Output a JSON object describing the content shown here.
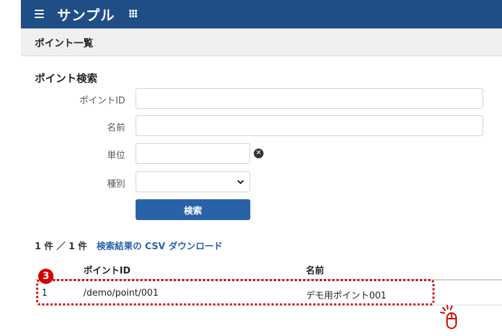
{
  "header": {
    "app_title": "サンプル",
    "menu_icon": "hamburger-menu-icon",
    "apps_icon": "grid-apps-icon"
  },
  "page": {
    "title": "ポイント一覧"
  },
  "search": {
    "section_title": "ポイント検索",
    "fields": {
      "point_id": {
        "label": "ポイントID",
        "value": ""
      },
      "name": {
        "label": "名前",
        "value": ""
      },
      "unit": {
        "label": "単位",
        "value": ""
      },
      "type": {
        "label": "種別",
        "selected": ""
      }
    },
    "button_label": "検索"
  },
  "results": {
    "count_text": "1 件 ／ 1 件",
    "csv_link": "検索結果の CSV ダウンロード",
    "columns": [
      "",
      "ポイントID",
      "名前"
    ],
    "rows": [
      {
        "no": "1",
        "point_id": "/demo/point/001",
        "name": "デモ用ポイント001"
      }
    ]
  },
  "annotation": {
    "step_number": "3",
    "accent_color": "#d40000",
    "cursor_icon": "mouse-click-icon"
  },
  "colors": {
    "header_bg": "#1f4e87",
    "primary_button": "#2a62a8",
    "link": "#2a62a8"
  }
}
